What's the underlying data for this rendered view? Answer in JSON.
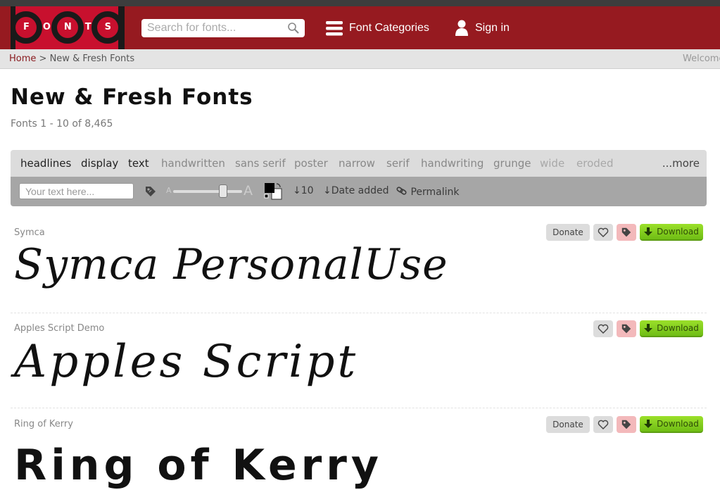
{
  "header": {
    "logo_text": "FONTS",
    "search_placeholder": "Search for fonts...",
    "categories_label": "Font Categories",
    "signin_label": "Sign in"
  },
  "breadcrumb": {
    "home": "Home",
    "separator": ">",
    "current": "New & Fresh Fonts",
    "welcome": "Welcome"
  },
  "page": {
    "title": "New & Fresh Fonts",
    "subtitle": "Fonts 1 - 10 of 8,465"
  },
  "categories": [
    {
      "label": "headlines"
    },
    {
      "label": "display"
    },
    {
      "label": "text"
    },
    {
      "label": "handwritten"
    },
    {
      "label": "sans serif"
    },
    {
      "label": "poster"
    },
    {
      "label": "narrow"
    },
    {
      "label": "serif"
    },
    {
      "label": "handwriting"
    },
    {
      "label": "grunge"
    },
    {
      "label": "wide"
    },
    {
      "label": "eroded"
    }
  ],
  "categories_more": "...more",
  "toolbar": {
    "text_placeholder": "Your text here...",
    "small_a": "A",
    "big_a": "A",
    "count": "10",
    "sort": "Date added",
    "permalink": "Permalink",
    "font_size_fraction": 0.72
  },
  "fonts": [
    {
      "name": "Symca",
      "preview": "Symca PersonalUse",
      "donate": "Donate",
      "download": "Download"
    },
    {
      "name": "Apples Script Demo",
      "preview": "Apples Script",
      "download": "Download"
    },
    {
      "name": "Ring of Kerry",
      "preview": "Ring of Kerry",
      "donate": "Donate",
      "download": "Download"
    }
  ],
  "colors": {
    "header_bg": "#961a20",
    "brand_red": "#c8102e",
    "download_green": "#7ccd1f",
    "tag_pink": "#f3b9bb"
  }
}
